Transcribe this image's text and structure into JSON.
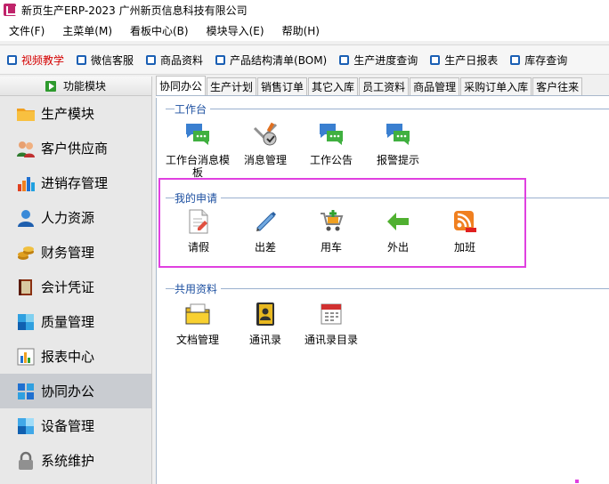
{
  "window": {
    "title": "新页生产ERP-2023 广州新页信息科技有限公司"
  },
  "menu": [
    "文件(F)",
    "主菜单(M)",
    "看板中心(B)",
    "模块导入(E)",
    "帮助(H)"
  ],
  "toolbar": [
    "视频教学",
    "微信客服",
    "商品资料",
    "产品结构清单(BOM)",
    "生产进度查询",
    "生产日报表",
    "库存查询"
  ],
  "sidebar": {
    "header": "功能模块",
    "items": [
      {
        "label": "生产模块",
        "icon": "folder-icon"
      },
      {
        "label": "客户供应商",
        "icon": "users-icon"
      },
      {
        "label": "进销存管理",
        "icon": "bar-chart-icon"
      },
      {
        "label": "人力资源",
        "icon": "person-icon"
      },
      {
        "label": "财务管理",
        "icon": "coins-icon"
      },
      {
        "label": "会计凭证",
        "icon": "book-icon"
      },
      {
        "label": "质量管理",
        "icon": "quality-icon"
      },
      {
        "label": "报表中心",
        "icon": "report-icon"
      },
      {
        "label": "协同办公",
        "icon": "grid-icon"
      },
      {
        "label": "设备管理",
        "icon": "device-icon"
      },
      {
        "label": "系统维护",
        "icon": "lock-icon"
      }
    ],
    "active_index": 8
  },
  "tabs": [
    "协同办公",
    "生产计划",
    "销售订单",
    "其它入库",
    "员工资料",
    "商品管理",
    "采购订单入库",
    "客户往来"
  ],
  "groups": [
    {
      "title": "工作台",
      "items": [
        "工作台消息模板",
        "消息管理",
        "工作公告",
        "报警提示"
      ]
    },
    {
      "title": "我的申请",
      "items": [
        "请假",
        "出差",
        "用车",
        "外出",
        "加班"
      ]
    },
    {
      "title": "共用资料",
      "items": [
        "文档管理",
        "通讯录",
        "通讯录目录"
      ]
    }
  ],
  "colors": {
    "highlight": "#e040e0",
    "group_title": "#1c4fa0",
    "active_sidebar": "#c9ccd1",
    "toolbar_red": "#d40000"
  }
}
